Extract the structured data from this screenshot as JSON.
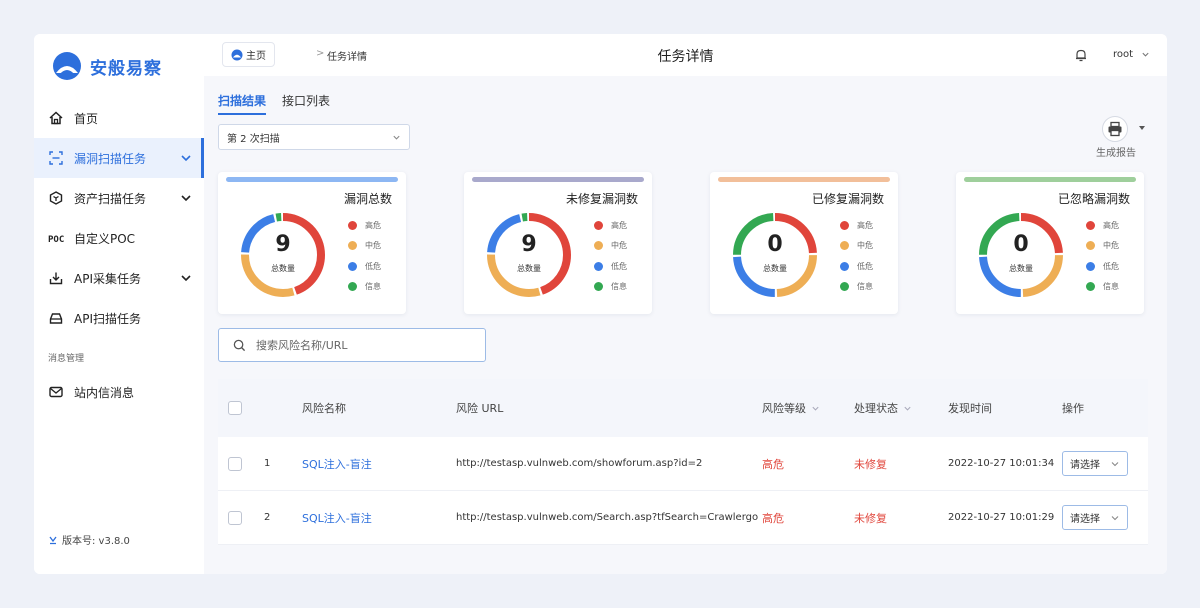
{
  "brand": {
    "name": "安般易察"
  },
  "sidebar": {
    "items": [
      {
        "label": "首页"
      },
      {
        "label": "漏洞扫描任务"
      },
      {
        "label": "资产扫描任务"
      },
      {
        "label": "自定义POC"
      },
      {
        "label": "API采集任务"
      },
      {
        "label": "API扫描任务"
      }
    ],
    "section_label": "消息管理",
    "message_item": "站内信消息",
    "version": "版本号: v3.8.0"
  },
  "topbar": {
    "home": "主页",
    "separator": ">",
    "current": "任务详情",
    "title": "任务详情",
    "user": "root"
  },
  "tabs": [
    {
      "label": "扫描结果"
    },
    {
      "label": "接口列表"
    }
  ],
  "scan_select": {
    "value": "第 2 次扫描"
  },
  "report": {
    "label": "生成报告"
  },
  "cards": [
    {
      "title": "漏洞总数",
      "count": "9",
      "count_label": "总数量",
      "accent": "#8db7f3",
      "segments": [
        {
          "color": "#e0453b",
          "value": 0.455
        },
        {
          "color": "#eeae55",
          "value": 0.305
        },
        {
          "color": "#3c7ee6",
          "value": 0.21
        },
        {
          "color": "#33a852",
          "value": 0.03
        }
      ]
    },
    {
      "title": "未修复漏洞数",
      "count": "9",
      "count_label": "总数量",
      "accent": "#a9a9cc",
      "segments": [
        {
          "color": "#e0453b",
          "value": 0.455
        },
        {
          "color": "#eeae55",
          "value": 0.305
        },
        {
          "color": "#3c7ee6",
          "value": 0.21
        },
        {
          "color": "#33a852",
          "value": 0.03
        }
      ]
    },
    {
      "title": "已修复漏洞数",
      "count": "0",
      "count_label": "总数量",
      "accent": "#f2bf9a",
      "segments": [
        {
          "color": "#e0453b",
          "value": 0.25
        },
        {
          "color": "#eeae55",
          "value": 0.25
        },
        {
          "color": "#3c7ee6",
          "value": 0.25
        },
        {
          "color": "#33a852",
          "value": 0.25
        }
      ]
    },
    {
      "title": "已忽略漏洞数",
      "count": "0",
      "count_label": "总数量",
      "accent": "#9fcf9c",
      "segments": [
        {
          "color": "#e0453b",
          "value": 0.25
        },
        {
          "color": "#eeae55",
          "value": 0.25
        },
        {
          "color": "#3c7ee6",
          "value": 0.25
        },
        {
          "color": "#33a852",
          "value": 0.25
        }
      ]
    }
  ],
  "legend": [
    {
      "label": "高危",
      "color": "#e0453b"
    },
    {
      "label": "中危",
      "color": "#eeae55"
    },
    {
      "label": "低危",
      "color": "#3c7ee6"
    },
    {
      "label": "信息",
      "color": "#33a852"
    }
  ],
  "search": {
    "placeholder": "搜索风险名称/URL"
  },
  "table": {
    "headers": {
      "name": "风险名称",
      "url": "风险 URL",
      "level": "风险等级",
      "status": "处理状态",
      "time": "发现时间",
      "op": "操作"
    },
    "rows": [
      {
        "idx": "1",
        "name": "SQL注入-盲注",
        "url": "http://testasp.vulnweb.com/showforum.asp?id=2",
        "level": "高危",
        "status": "未修复",
        "time": "2022-10-27 10:01:34",
        "op": "请选择"
      },
      {
        "idx": "2",
        "name": "SQL注入-盲注",
        "url": "http://testasp.vulnweb.com/Search.asp?tfSearch=Crawlergo",
        "level": "高危",
        "status": "未修复",
        "time": "2022-10-27 10:01:29",
        "op": "请选择"
      }
    ]
  },
  "colors": {
    "primary": "#2d6fdc",
    "danger": "#e0453b"
  }
}
